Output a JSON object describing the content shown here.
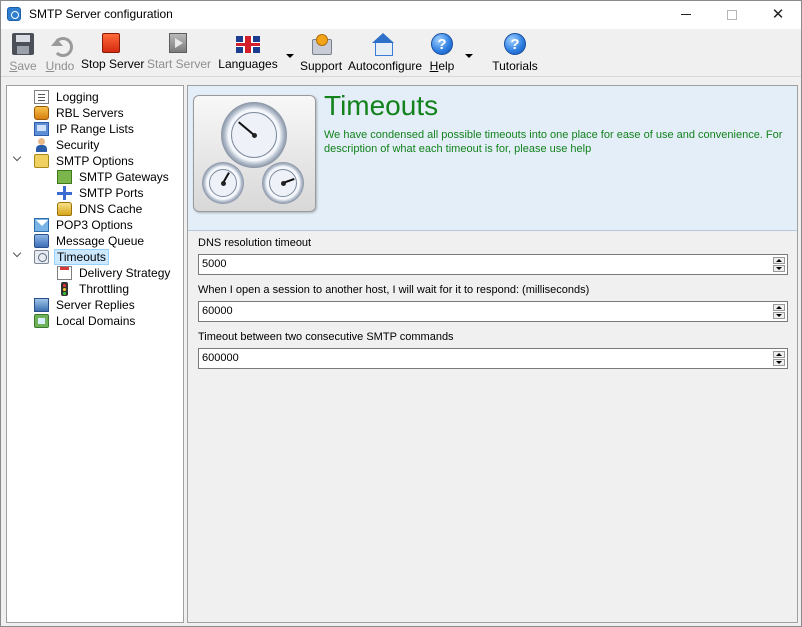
{
  "window": {
    "title": "SMTP Server configuration"
  },
  "toolbar": {
    "save_label": "Save",
    "undo_label": "Undo",
    "stop_label": "Stop Server",
    "start_label": "Start Server",
    "languages_label": "Languages",
    "support_label": "Support",
    "autoconfigure_label": "Autoconfigure",
    "help_label": "Help",
    "tutorials_label": "Tutorials"
  },
  "tree": {
    "items": [
      {
        "label": "Logging",
        "icon": "log-icon"
      },
      {
        "label": "RBL Servers",
        "icon": "rbl-icon"
      },
      {
        "label": "IP Range Lists",
        "icon": "ip-range-icon"
      },
      {
        "label": "Security",
        "icon": "security-icon"
      },
      {
        "label": "SMTP Options",
        "icon": "smtp-options-icon"
      },
      {
        "label": "SMTP Gateways",
        "icon": "gateways-icon"
      },
      {
        "label": "SMTP Ports",
        "icon": "ports-icon"
      },
      {
        "label": "DNS Cache",
        "icon": "dns-cache-icon"
      },
      {
        "label": "POP3 Options",
        "icon": "pop3-icon"
      },
      {
        "label": "Message Queue",
        "icon": "queue-icon"
      },
      {
        "label": "Timeouts",
        "icon": "timeouts-icon"
      },
      {
        "label": "Delivery Strategy",
        "icon": "delivery-icon"
      },
      {
        "label": "Throttling",
        "icon": "throttling-icon"
      },
      {
        "label": "Server Replies",
        "icon": "server-replies-icon"
      },
      {
        "label": "Local Domains",
        "icon": "local-domains-icon"
      }
    ],
    "selected": "Timeouts"
  },
  "header": {
    "title": "Timeouts",
    "description": "We have condensed all possible timeouts into one place for ease of use and convenience. For description of what each  timeout is for, please use help",
    "accent_color": "#13821c"
  },
  "fields": {
    "dns_label": "DNS resolution timeout",
    "dns_value": "5000",
    "session_label": "When I open a session to another host, I will wait for it to respond: (milliseconds)",
    "session_value": "60000",
    "commands_label": "Timeout between two consecutive SMTP commands",
    "commands_value": "600000"
  }
}
